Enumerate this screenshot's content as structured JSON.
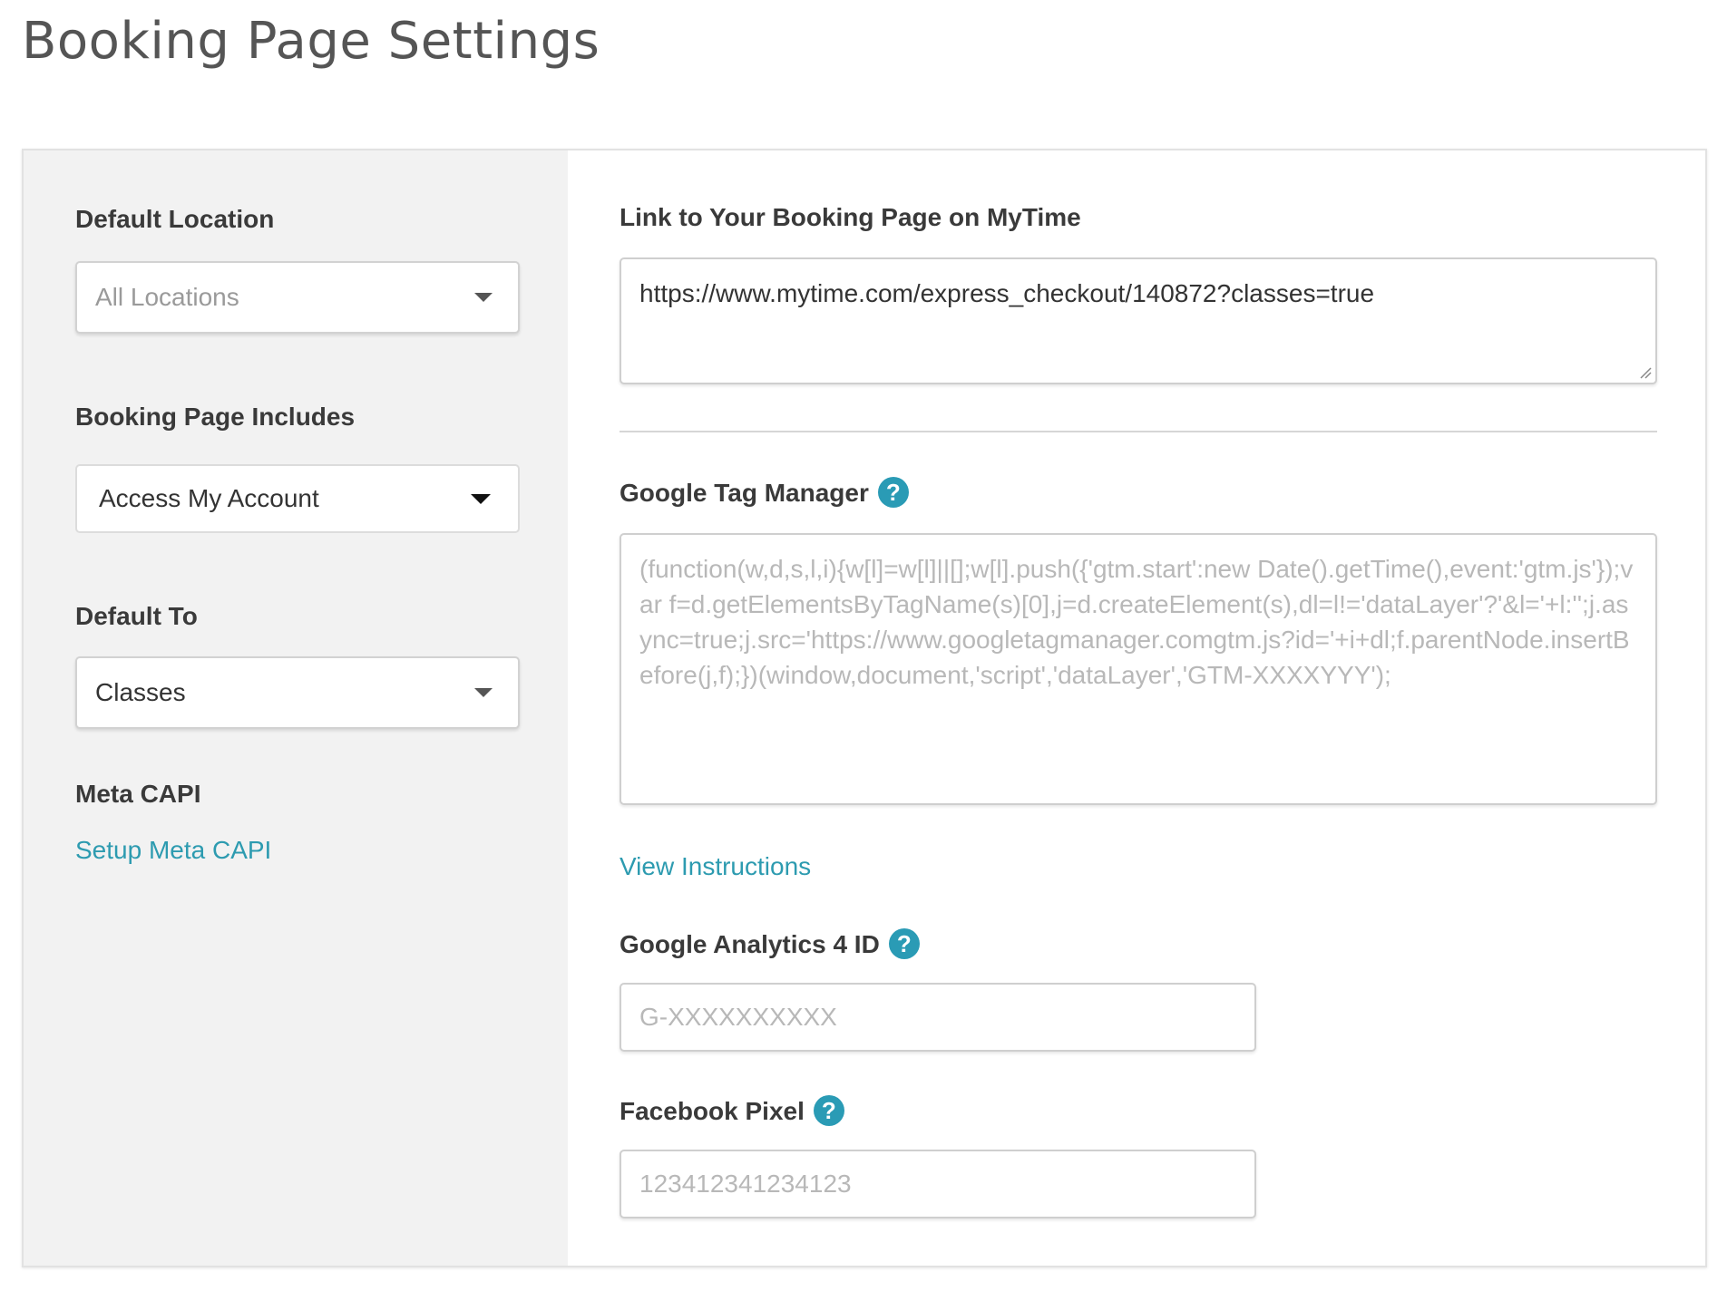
{
  "page": {
    "title": "Booking Page Settings"
  },
  "left": {
    "default_location": {
      "label": "Default Location",
      "value": "All Locations"
    },
    "booking_page_includes": {
      "label": "Booking Page Includes",
      "value": "Access My Account"
    },
    "default_to": {
      "label": "Default To",
      "value": "Classes"
    },
    "meta_capi": {
      "label": "Meta CAPI",
      "link": "Setup Meta CAPI"
    }
  },
  "right": {
    "booking_link": {
      "label": "Link to Your Booking Page on MyTime",
      "value": "https://www.mytime.com/express_checkout/140872?classes=true"
    },
    "gtm": {
      "label": "Google Tag Manager",
      "help": "?",
      "placeholder": "(function(w,d,s,l,i){w[l]=w[l]||[];w[l].push({'gtm.start':new Date().getTime(),event:'gtm.js'});var f=d.getElementsByTagName(s)[0],j=d.createElement(s),dl=l!='dataLayer'?'&l='+l:'';j.async=true;j.src='https://www.googletagmanager.comgtm.js?id='+i+dl;f.parentNode.insertBefore(j,f);})(window,document,'script','dataLayer','GTM-XXXXYYY');",
      "instructions_link": "View Instructions"
    },
    "ga4": {
      "label": "Google Analytics 4 ID",
      "help": "?",
      "placeholder": "G-XXXXXXXXXX"
    },
    "facebook_pixel": {
      "label": "Facebook Pixel",
      "help": "?",
      "placeholder": "123412341234123"
    }
  },
  "colors": {
    "accent": "#2d9bb0",
    "help_icon": "#2a9bb5",
    "left_panel_bg": "#f2f2f2",
    "placeholder": "#b8b8b8"
  }
}
